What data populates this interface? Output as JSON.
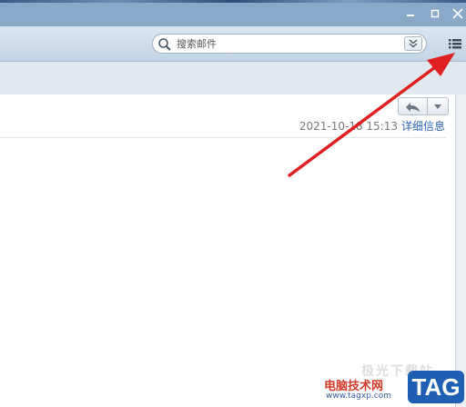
{
  "search": {
    "placeholder": "搜索邮件"
  },
  "message": {
    "date": "2021-10-18 15:13",
    "details_link": "详细信息"
  },
  "watermark": {
    "cn_text": "极光下载站",
    "brand_name": "电脑技术网",
    "url": "www.tagxp.com",
    "tag": "TAG"
  },
  "colors": {
    "annotation_arrow": "#e02020",
    "link": "#2f63b0",
    "tag_badge": "#1f5fb3",
    "titlebar": "#8aa8c8"
  },
  "icons": {
    "minimize": "minimize-icon",
    "maximize": "maximize-icon",
    "close": "close-icon",
    "search": "search-icon",
    "filter": "double-chevron-down-icon",
    "list_menu": "list-menu-icon",
    "reply": "reply-icon",
    "more": "triangle-down-icon"
  }
}
